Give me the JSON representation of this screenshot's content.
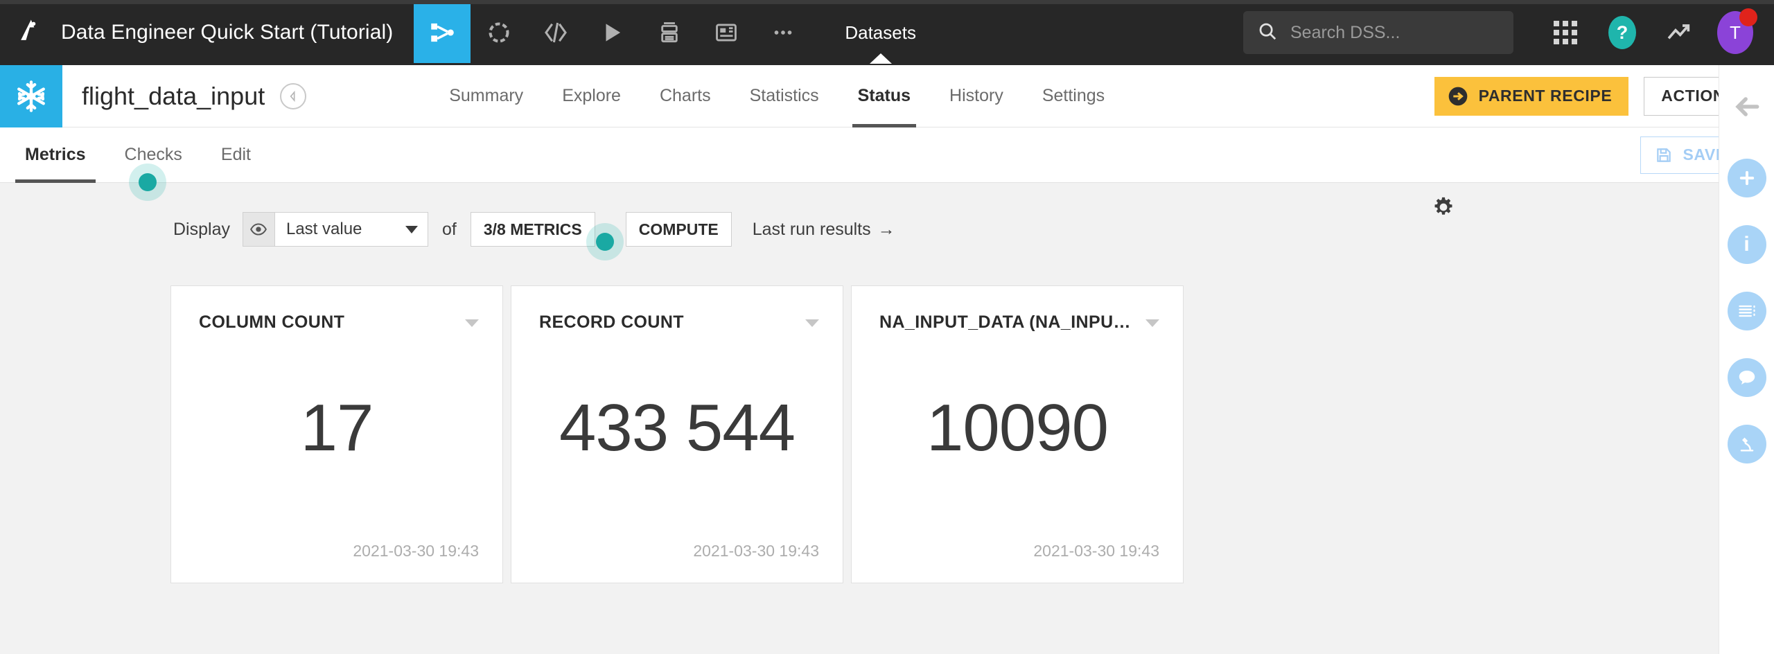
{
  "topbar": {
    "logo_icon": "dataiku-logo-icon",
    "project_title": "Data Engineer Quick Start (Tutorial)",
    "tools": [
      {
        "name": "flow-icon",
        "label": "Flow",
        "active": true
      },
      {
        "name": "lab-icon",
        "label": "Lab",
        "active": false
      },
      {
        "name": "code-icon",
        "label": "Code",
        "active": false
      },
      {
        "name": "run-icon",
        "label": "Run",
        "active": false
      },
      {
        "name": "jobs-icon",
        "label": "Jobs",
        "active": false
      },
      {
        "name": "dashboard-icon",
        "label": "Dashboards",
        "active": false
      },
      {
        "name": "more-icon",
        "label": "More",
        "active": false
      }
    ],
    "section_label": "Datasets",
    "search": {
      "placeholder": "Search DSS...",
      "value": "",
      "icon": "search-icon"
    },
    "apps_icon": "apps-grid-icon",
    "help_label": "?",
    "trend_icon": "trend-up-icon",
    "avatar_initial": "T",
    "notification_dot": true,
    "accent_blue": "#2ab1e8",
    "bar_bg": "#272727"
  },
  "dataset": {
    "logo_icon": "snowflake-icon",
    "name": "flight_data_input",
    "badge_icon": "navigator-icon",
    "tabs": [
      {
        "label": "Summary",
        "active": false
      },
      {
        "label": "Explore",
        "active": false
      },
      {
        "label": "Charts",
        "active": false
      },
      {
        "label": "Statistics",
        "active": false
      },
      {
        "label": "Status",
        "active": true
      },
      {
        "label": "History",
        "active": false
      },
      {
        "label": "Settings",
        "active": false
      }
    ],
    "parent_recipe_label": "PARENT RECIPE",
    "parent_recipe_icon": "arrow-right-circle-icon",
    "parent_recipe_color": "#fbc13c",
    "actions_label": "ACTIONS"
  },
  "subtabs": {
    "items": [
      {
        "label": "Metrics",
        "active": true
      },
      {
        "label": "Checks",
        "active": false
      },
      {
        "label": "Edit",
        "active": false
      }
    ],
    "saved_label": "SAVED",
    "saved_icon": "floppy-disk-icon"
  },
  "controls": {
    "display_label": "Display",
    "eye_icon": "eye-icon",
    "display_value": "Last value",
    "of_label": "of",
    "metrics_button": "3/8 METRICS",
    "compute_button": "COMPUTE",
    "last_run_label": "Last run results",
    "last_run_arrow": "→",
    "gear_icon": "gear-icon"
  },
  "metrics": {
    "cards": [
      {
        "title": "COLUMN COUNT",
        "value": "17",
        "timestamp": "2021-03-30 19:43"
      },
      {
        "title": "RECORD COUNT",
        "value": "433 544",
        "timestamp": "2021-03-30 19:43"
      },
      {
        "title": "NA_INPUT_DATA (NA_INPUT_DATA)",
        "value": "10090",
        "timestamp": "2021-03-30 19:43"
      }
    ]
  },
  "right_rail": {
    "collapse_icon": "arrow-left-icon",
    "items": [
      {
        "name": "add-icon",
        "glyph": "+"
      },
      {
        "name": "info-icon",
        "glyph": "i"
      },
      {
        "name": "details-icon",
        "glyph": ""
      },
      {
        "name": "discussions-icon",
        "glyph": ""
      },
      {
        "name": "lab-microscope-icon",
        "glyph": ""
      }
    ],
    "accent": "#a9d4f7"
  },
  "highlights": {
    "teal": "#1aa9a3"
  }
}
